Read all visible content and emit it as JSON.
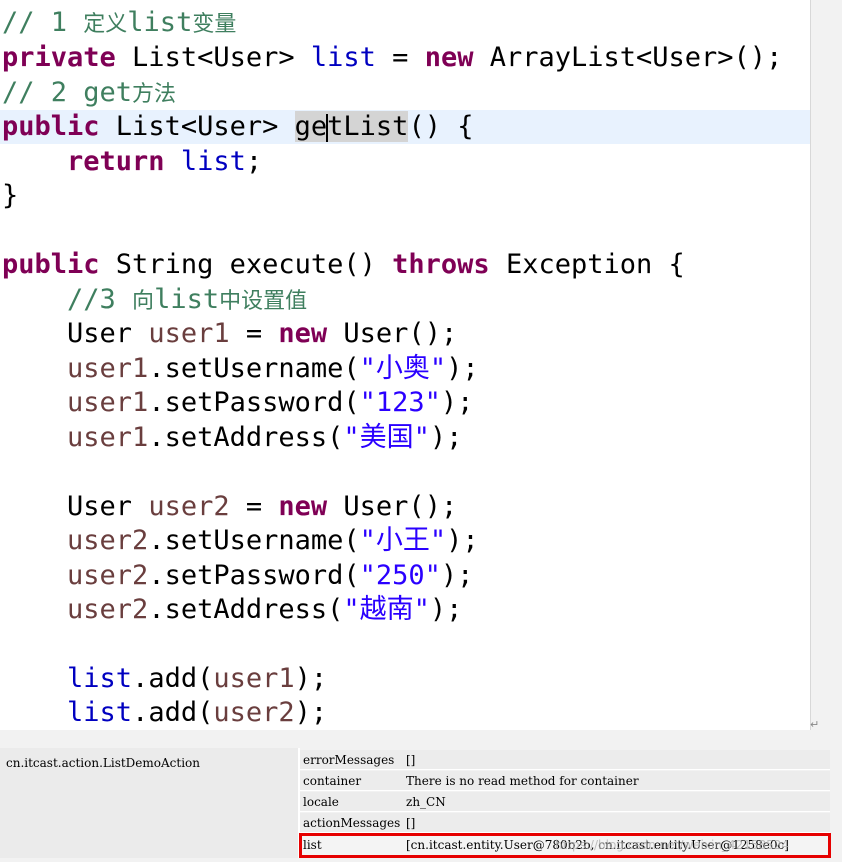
{
  "code": {
    "c1_slash": "// 1 ",
    "c1_cjk1": "定义",
    "c1_mono": "list",
    "c1_cjk2": "变量",
    "l2_kw": "private",
    "l2_type": " List<User> ",
    "l2_field": "list",
    "l2_eq": " = ",
    "l2_new": "new",
    "l2_rest": " ArrayList<User>();",
    "c2_slash": "// 2 get",
    "c2_cjk": "方法",
    "l4_kw": "public",
    "l4_type": " List<User> ",
    "l4_m1": "ge",
    "l4_m2": "t",
    "l4_m3": "List",
    "l4_rest": "() {",
    "l5_indent": "    ",
    "l5_kw": "return",
    "l5_sp": " ",
    "l5_field": "list",
    "l5_end": ";",
    "l6": "}",
    "l8_kw": "public",
    "l8_mid": " String execute() ",
    "l8_kw2": "throws",
    "l8_rest": " Exception {",
    "c3_slash": "    //3 ",
    "c3_cjk1": "向",
    "c3_mono": "list",
    "c3_cjk2": "中设置值",
    "l10_a": "    User ",
    "l10_var": "user1",
    "l10_eq": " = ",
    "l10_new": "new",
    "l10_rest": " User();",
    "l11_indent": "    ",
    "l11_var": "user1",
    "l11_call": ".setUsername(",
    "l11_str": "\"小奥\"",
    "l11_end": ");",
    "l12_indent": "    ",
    "l12_var": "user1",
    "l12_call": ".setPassword(",
    "l12_str": "\"123\"",
    "l12_end": ");",
    "l13_indent": "    ",
    "l13_var": "user1",
    "l13_call": ".setAddress(",
    "l13_str": "\"美国\"",
    "l13_end": ");",
    "l15_a": "    User ",
    "l15_var": "user2",
    "l15_eq": " = ",
    "l15_new": "new",
    "l15_rest": " User();",
    "l16_indent": "    ",
    "l16_var": "user2",
    "l16_call": ".setUsername(",
    "l16_str": "\"小王\"",
    "l16_end": ");",
    "l17_indent": "    ",
    "l17_var": "user2",
    "l17_call": ".setPassword(",
    "l17_str": "\"250\"",
    "l17_end": ");",
    "l18_indent": "    ",
    "l18_var": "user2",
    "l18_call": ".setAddress(",
    "l18_str": "\"越南\"",
    "l18_end": ");",
    "l20_indent": "    ",
    "l20_field": "list",
    "l20_call": ".add(",
    "l20_var": "user1",
    "l20_end": ");",
    "l21_indent": "    ",
    "l21_field": "list",
    "l21_call": ".add(",
    "l21_var": "user2",
    "l21_end": ");"
  },
  "debug": {
    "action": "cn.itcast.action.ListDemoAction",
    "rows": [
      {
        "key": "errorMessages",
        "value": "[]"
      },
      {
        "key": "container",
        "value": "There is no read method for container"
      },
      {
        "key": "locale",
        "value": "zh_CN"
      },
      {
        "key": "actionMessages",
        "value": "[]"
      },
      {
        "key": "list",
        "value": "[cn.itcast.entity.User@780b2b, cn.itcast.entity.User@1258e0c]"
      }
    ]
  },
  "watermark": "https://blog.csdn.net/weixin_42158524"
}
